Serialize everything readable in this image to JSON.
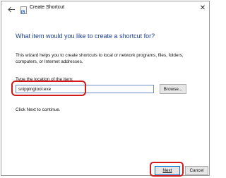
{
  "window": {
    "title": "Create Shortcut",
    "back_icon": "back-arrow-icon",
    "app_icon": "shortcut-icon",
    "close_glyph": "✕"
  },
  "main": {
    "heading": "What item would you like to create a shortcut for?",
    "description": "This wizard helps you to create shortcuts to local or network programs, files, folders, computers, or Internet addresses.",
    "location_label": "Type the location of the item:",
    "location_value": "snippingtool.exe",
    "browse_label": "Browse...",
    "hint": "Click Next to continue."
  },
  "footer": {
    "next_label": "Next",
    "cancel_label": "Cancel"
  },
  "colors": {
    "heading": "#1a3e9a",
    "highlight": "#d21a1a",
    "focus_border": "#0078d7"
  }
}
